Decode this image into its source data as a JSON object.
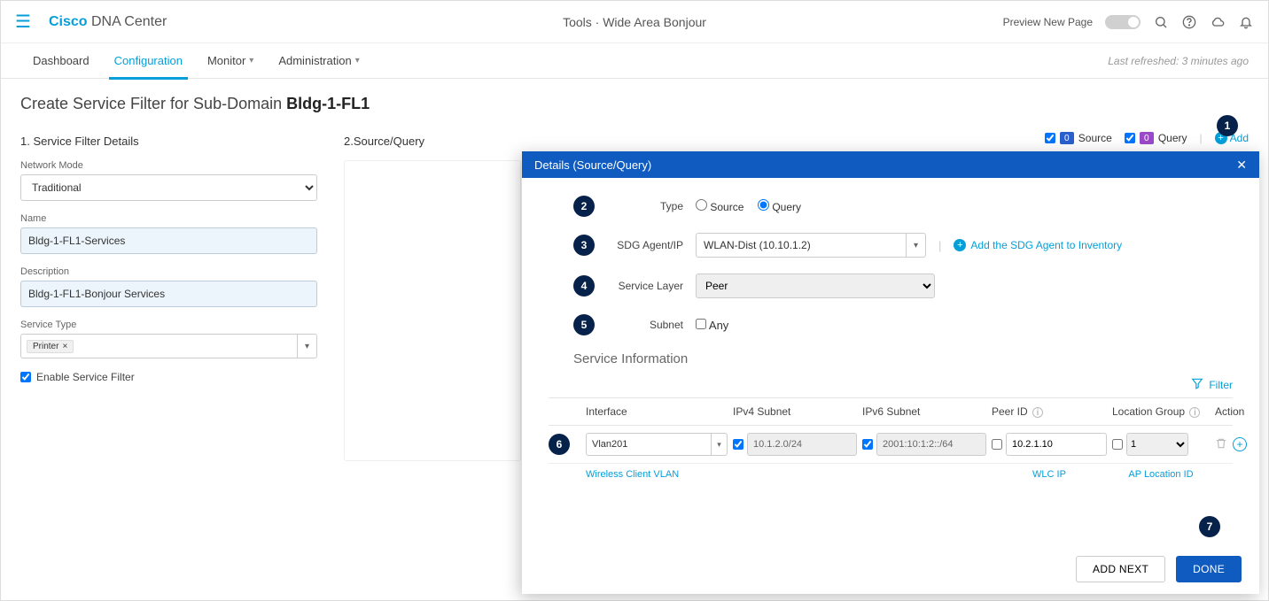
{
  "header": {
    "brand_cisco": "Cisco",
    "brand_dna": " DNA Center",
    "breadcrumb": "Tools · Wide Area Bonjour",
    "preview_label": "Preview New Page"
  },
  "tabs": {
    "dashboard": "Dashboard",
    "configuration": "Configuration",
    "monitor": "Monitor",
    "administration": "Administration",
    "last_refreshed": "Last refreshed: 3 minutes ago"
  },
  "page": {
    "title_prefix": "Create Service Filter for Sub-Domain ",
    "title_domain": "Bldg-1-FL1"
  },
  "left": {
    "section_title": "1. Service Filter Details",
    "network_mode_label": "Network Mode",
    "network_mode_value": "Traditional",
    "name_label": "Name",
    "name_value": "Bldg-1-FL1-Services",
    "description_label": "Description",
    "description_value": "Bldg-1-FL1-Bonjour Services",
    "service_type_label": "Service Type",
    "service_type_chip": "Printer",
    "enable_label": "Enable Service Filter"
  },
  "right": {
    "section_title": "2.Source/Query",
    "source_count": "0",
    "source_label": "Source",
    "query_count": "0",
    "query_label": "Query",
    "add_label": "Add"
  },
  "modal": {
    "title": "Details (Source/Query)",
    "type_label": "Type",
    "type_source": "Source",
    "type_query": "Query",
    "sdg_label": "SDG Agent/IP",
    "sdg_value": "WLAN-Dist (10.10.1.2)",
    "inventory_link": "Add the SDG Agent to Inventory",
    "service_layer_label": "Service Layer",
    "service_layer_value": "Peer",
    "subnet_label": "Subnet",
    "subnet_any": "Any",
    "service_info_heading": "Service Information",
    "filter_label": "Filter",
    "col_interface": "Interface",
    "col_ipv4": "IPv4 Subnet",
    "col_ipv6": "IPv6 Subnet",
    "col_peerid": "Peer ID",
    "col_location": "Location Group",
    "col_action": "Action",
    "row": {
      "interface": "Vlan201",
      "ipv4": "10.1.2.0/24",
      "ipv6": "2001:10:1:2::/64",
      "peerid": "10.2.1.10",
      "location": "1"
    },
    "hint_interface": "Wireless Client VLAN",
    "hint_peerid": "WLC IP",
    "hint_location": "AP Location ID",
    "btn_addnext": "ADD NEXT",
    "btn_done": "DONE"
  },
  "callouts": {
    "c1": "1",
    "c2": "2",
    "c3": "3",
    "c4": "4",
    "c5": "5",
    "c6": "6",
    "c7": "7"
  }
}
